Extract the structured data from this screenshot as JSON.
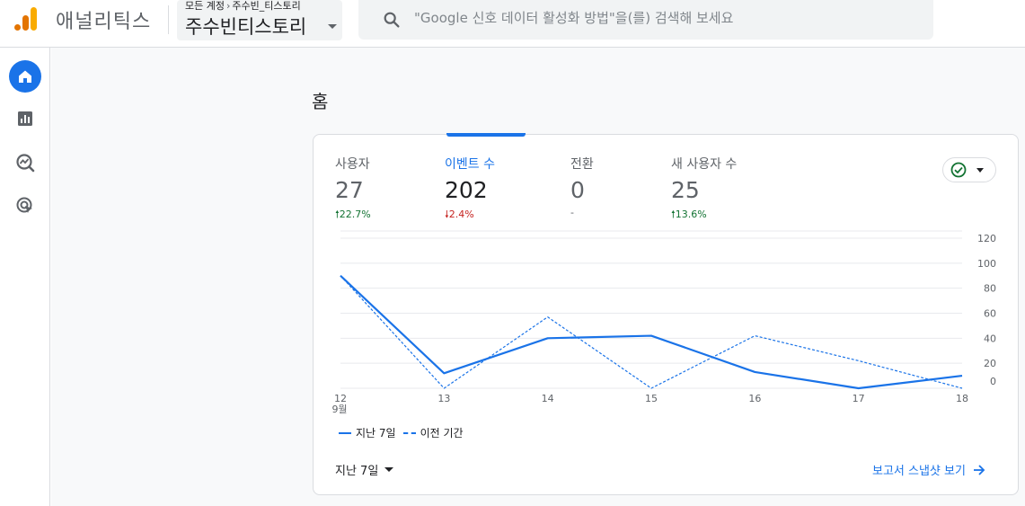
{
  "header": {
    "app_title": "애널리틱스",
    "breadcrumb": {
      "account": "모든 계정",
      "property": "주수빈_티스토리"
    },
    "property_selector": "주수빈티스토리",
    "search_placeholder": "\"Google 신호 데이터 활성화 방법\"을(를) 검색해 보세요"
  },
  "sidebar": {
    "items": [
      {
        "name": "home",
        "icon": "home-icon",
        "active": true
      },
      {
        "name": "reports",
        "icon": "bar-chart-icon",
        "active": false
      },
      {
        "name": "explore",
        "icon": "explore-icon",
        "active": false
      },
      {
        "name": "advertising",
        "icon": "target-cursor-icon",
        "active": false
      }
    ]
  },
  "page": {
    "title": "홈"
  },
  "metrics": [
    {
      "label": "사용자",
      "value": "27",
      "change": "22.7%",
      "direction": "up"
    },
    {
      "label": "이벤트 수",
      "value": "202",
      "change": "2.4%",
      "direction": "down"
    },
    {
      "label": "전환",
      "value": "0",
      "change": "-",
      "direction": "none"
    },
    {
      "label": "새 사용자 수",
      "value": "25",
      "change": "13.6%",
      "direction": "up"
    }
  ],
  "legend": {
    "current": "지난 7일",
    "previous": "이전 기간"
  },
  "footer": {
    "date_range": "지난 7일",
    "report_link": "보고서 스냅샷 보기"
  },
  "chart_data": {
    "type": "line",
    "x": [
      "12",
      "13",
      "14",
      "15",
      "16",
      "17",
      "18"
    ],
    "x_sublabel": "9월",
    "y_ticks": [
      "0",
      "20",
      "40",
      "60",
      "80",
      "100",
      "120"
    ],
    "ylim": [
      0,
      120
    ],
    "grid": true,
    "series": [
      {
        "name": "지난 7일",
        "style": "solid",
        "values": [
          90,
          12,
          40,
          42,
          13,
          0,
          10
        ]
      },
      {
        "name": "이전 기간",
        "style": "dashed",
        "values": [
          90,
          0,
          57,
          0,
          42,
          22,
          0
        ]
      }
    ],
    "colors": {
      "line": "#1a73e8",
      "grid": "#e8eaed"
    }
  }
}
